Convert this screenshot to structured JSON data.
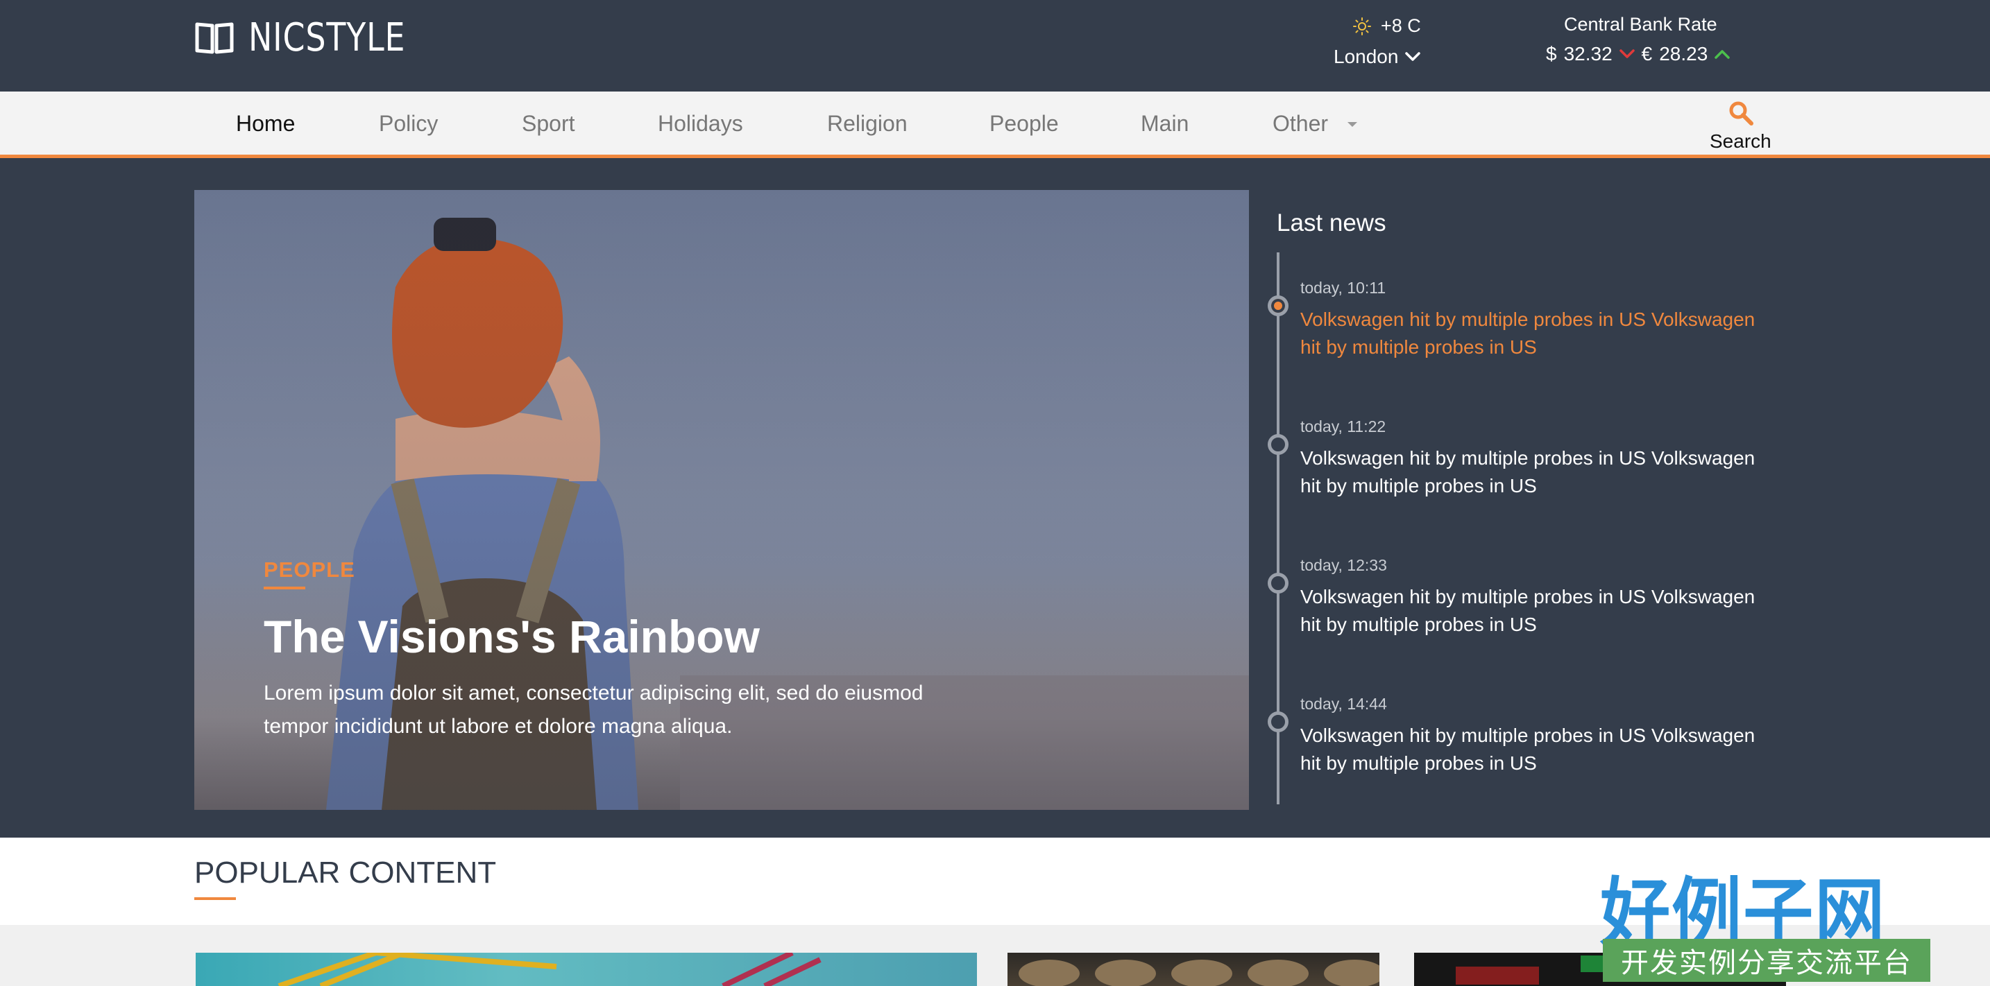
{
  "header": {
    "logo_text": "NICSTYLE",
    "weather": {
      "temp": "+8 C",
      "city": "London"
    },
    "rates": {
      "title": "Central Bank Rate",
      "usd_symbol": "$",
      "usd_value": "32.32",
      "eur_symbol": "€",
      "eur_value": "28.23"
    }
  },
  "nav": {
    "items": [
      {
        "label": "Home"
      },
      {
        "label": "Policy"
      },
      {
        "label": "Sport"
      },
      {
        "label": "Holidays"
      },
      {
        "label": "Religion"
      },
      {
        "label": "People"
      },
      {
        "label": "Main"
      },
      {
        "label": "Other"
      }
    ],
    "search_label": "Search"
  },
  "hero": {
    "category": "PEOPLE",
    "title": "The Visions's Rainbow",
    "text": "Lorem ipsum dolor sit amet, consectetur adipiscing elit, sed do eiusmod tempor incididunt ut labore et dolore magna aliqua."
  },
  "last_news": {
    "title": "Last news",
    "items": [
      {
        "time": "today, 10:11",
        "headline": "Volkswagen hit by multiple probes in US Volkswagen hit by multiple probes in US"
      },
      {
        "time": "today, 11:22",
        "headline": "Volkswagen hit by multiple probes in US Volkswagen hit by multiple probes in US"
      },
      {
        "time": "today, 12:33",
        "headline": "Volkswagen hit by multiple probes in US Volkswagen hit by multiple probes in US"
      },
      {
        "time": "today, 14:44",
        "headline": "Volkswagen hit by multiple probes in US Volkswagen hit by multiple probes in US"
      }
    ]
  },
  "popular": {
    "title": "POPULAR CONTENT"
  },
  "badge": {
    "main": "好例子网",
    "sub": "开发实例分享交流平台"
  },
  "colors": {
    "accent": "#f0883e",
    "header_bg": "#343d4b",
    "nav_bg": "#f3f3f3",
    "up": "#4cc04c",
    "down": "#e03a3a"
  }
}
